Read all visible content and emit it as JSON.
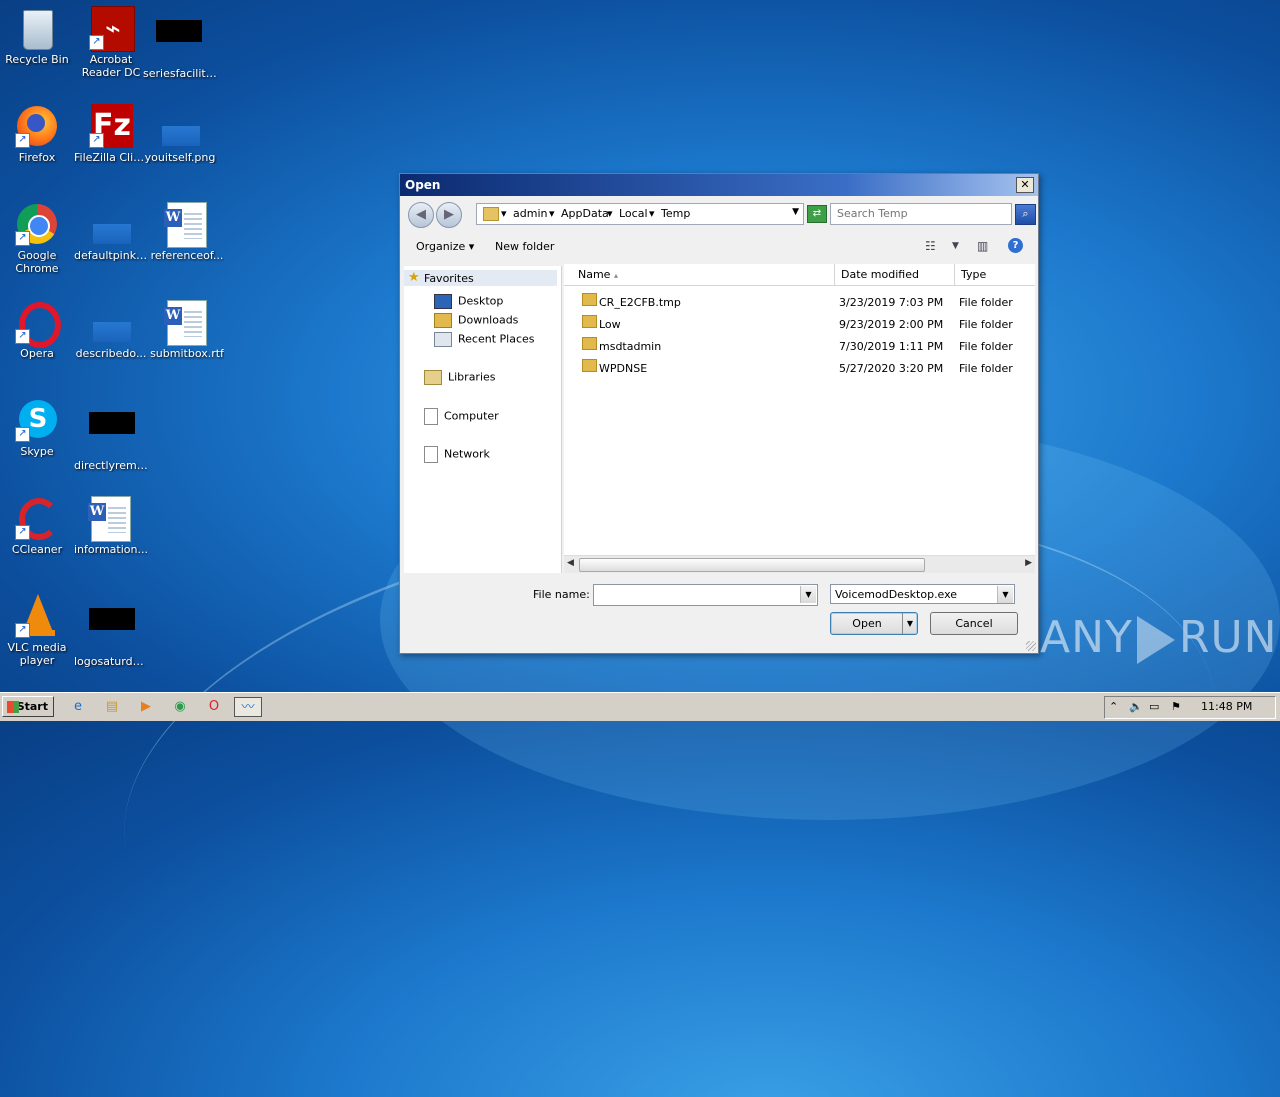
{
  "desktop": {
    "icons": [
      {
        "label": "Recycle Bin",
        "icon": "recycle-bin-icon"
      },
      {
        "label": "Acrobat Reader DC",
        "label1": "Acrobat",
        "label2": "Reader DC",
        "icon": "acrobat-icon"
      },
      {
        "label": "seriesfaciliti...",
        "icon": "file-icon"
      },
      {
        "label": "Firefox",
        "icon": "firefox-icon"
      },
      {
        "label": "FileZilla Client",
        "icon": "filezilla-icon"
      },
      {
        "label": "youitself.png",
        "icon": "image-file-icon"
      },
      {
        "label": "Google Chrome",
        "label1": "Google",
        "label2": "Chrome",
        "icon": "chrome-icon"
      },
      {
        "label": "defaultpink....",
        "icon": "file-icon"
      },
      {
        "label": "referenceof...",
        "icon": "word-doc-icon"
      },
      {
        "label": "Opera",
        "icon": "opera-icon"
      },
      {
        "label": "describedo...",
        "icon": "file-icon"
      },
      {
        "label": "submitbox.rtf",
        "icon": "word-doc-icon"
      },
      {
        "label": "Skype",
        "icon": "skype-icon"
      },
      {
        "label": "directlyremo...",
        "icon": "file-icon"
      },
      {
        "label": "CCleaner",
        "icon": "ccleaner-icon"
      },
      {
        "label": "information...",
        "icon": "word-doc-icon"
      },
      {
        "label": "VLC media player",
        "label1": "VLC media",
        "label2": "player",
        "icon": "vlc-icon"
      },
      {
        "label": "logosaturda...",
        "icon": "file-icon"
      }
    ]
  },
  "dialog": {
    "title": "Open",
    "address": {
      "crumbs": [
        "admin",
        "AppData",
        "Local",
        "Temp"
      ]
    },
    "search": {
      "placeholder": "Search Temp"
    },
    "toolbar": {
      "organize": "Organize",
      "new_folder": "New folder"
    },
    "nav": {
      "favorites": "Favorites",
      "desktop": "Desktop",
      "downloads": "Downloads",
      "recent": "Recent Places",
      "libraries": "Libraries",
      "computer": "Computer",
      "network": "Network"
    },
    "columns": {
      "name": "Name",
      "date": "Date modified",
      "type": "Type"
    },
    "files": [
      {
        "name": "CR_E2CFB.tmp",
        "date": "3/23/2019 7:03 PM",
        "type": "File folder"
      },
      {
        "name": "Low",
        "date": "9/23/2019 2:00 PM",
        "type": "File folder"
      },
      {
        "name": "msdtadmin",
        "date": "7/30/2019 1:11 PM",
        "type": "File folder"
      },
      {
        "name": "WPDNSE",
        "date": "5/27/2020 3:20 PM",
        "type": "File folder"
      }
    ],
    "file_name_label": "File name:",
    "file_name_value": "",
    "file_type_value": "VoicemodDesktop.exe",
    "open_label": "Open",
    "cancel_label": "Cancel"
  },
  "watermark": {
    "left": "ANY",
    "right": "RUN"
  },
  "taskbar": {
    "start_label": "Start",
    "clock": "11:48 PM"
  }
}
